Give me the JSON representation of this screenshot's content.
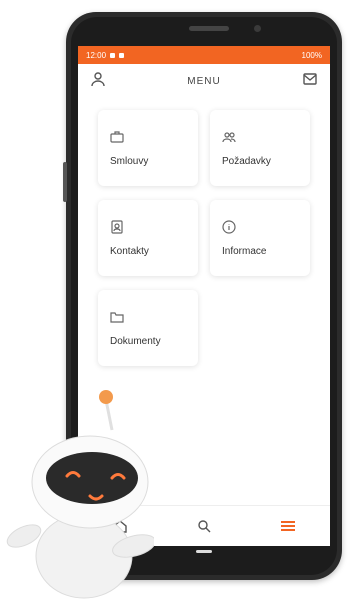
{
  "status": {
    "time": "12:00",
    "battery": "100%"
  },
  "appbar": {
    "title": "MENU"
  },
  "menu": {
    "items": [
      {
        "label": "Smlouvy",
        "icon": "briefcase-icon"
      },
      {
        "label": "Požadavky",
        "icon": "people-icon"
      },
      {
        "label": "Kontakty",
        "icon": "contacts-icon"
      },
      {
        "label": "Informace",
        "icon": "info-icon"
      },
      {
        "label": "Dokumenty",
        "icon": "folder-icon"
      }
    ]
  },
  "bottomnav": {
    "items": [
      "home-icon",
      "search-icon",
      "menu-icon"
    ]
  },
  "colors": {
    "accent": "#f26522",
    "phone": "#2b2b2b"
  }
}
